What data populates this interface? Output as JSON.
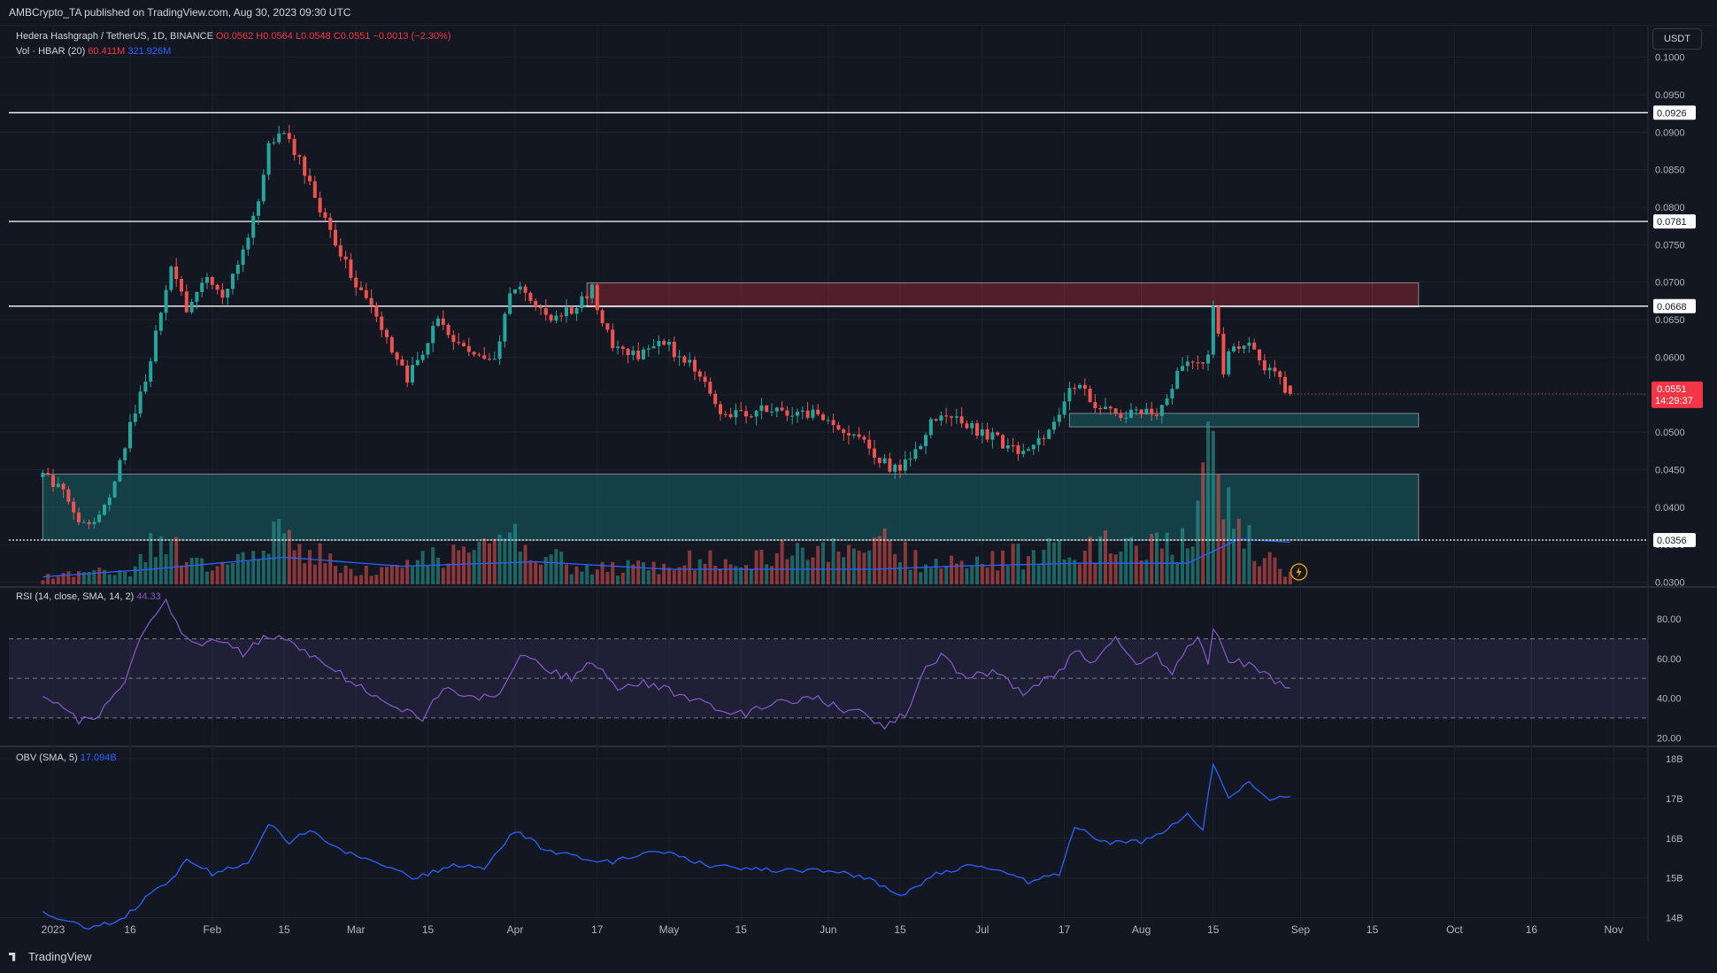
{
  "header": {
    "published": "AMBCrypto_TA published on TradingView.com, Aug 30, 2023 09:30 UTC"
  },
  "legend": {
    "symbol": "Hedera Hashgraph / TetherUS, 1D, BINANCE",
    "o": "O0.0562",
    "h": "H0.0564",
    "l": "L0.0548",
    "c": "C0.0551",
    "chg": "−0.0013 (−2.30%)",
    "vol_label": "Vol · HBAR (20)",
    "vol_val": "60.411M",
    "vol_sma": "321.926M",
    "rsi_label": "RSI (14, close, SMA, 14, 2)",
    "rsi_val": "44.33",
    "obv_label": "OBV (SMA, 5)",
    "obv_val": "17.094B"
  },
  "currency_button": "USDT",
  "price_badge": {
    "price": "0.0551",
    "countdown": "14:29:37"
  },
  "footer": {
    "brand": "TradingView"
  },
  "colors": {
    "up": "#26a69a",
    "down": "#ef5350",
    "bg": "#131722",
    "grid": "#1e222d",
    "volume_sma": "#2962ff",
    "rsi": "#7e57c2",
    "obv": "#2962ff",
    "supply_zone": "#f23645",
    "demand_zone": "#1b8a8a"
  },
  "chart_data": [
    {
      "type": "candlestick",
      "title": "Hedera Hashgraph / TetherUS, 1D, BINANCE",
      "x_ticks": [
        "2023",
        "16",
        "Feb",
        "15",
        "Mar",
        "15",
        "Apr",
        "17",
        "May",
        "15",
        "Jun",
        "15",
        "Jul",
        "17",
        "Aug",
        "15",
        "Sep",
        "15",
        "Oct",
        "16",
        "Nov"
      ],
      "x_tick_dates": [
        "2023-01-01",
        "2023-01-16",
        "2023-02-01",
        "2023-02-15",
        "2023-03-01",
        "2023-03-15",
        "2023-04-01",
        "2023-04-17",
        "2023-05-01",
        "2023-05-15",
        "2023-06-01",
        "2023-06-15",
        "2023-07-01",
        "2023-07-17",
        "2023-08-01",
        "2023-08-15",
        "2023-09-01",
        "2023-09-15",
        "2023-10-01",
        "2023-10-16",
        "2023-11-01"
      ],
      "y_ticks": [
        "0.1000",
        "0.0950",
        "0.0900",
        "0.0850",
        "0.0800",
        "0.0750",
        "0.0700",
        "0.0650",
        "0.0600",
        "0.0550",
        "0.0500",
        "0.0450",
        "0.0400",
        "0.0350",
        "0.0300"
      ],
      "ylim": [
        0.0297,
        0.1035
      ],
      "horizontal_levels": [
        {
          "value": 0.0926,
          "label": "0.0926"
        },
        {
          "value": 0.0781,
          "label": "0.0781"
        },
        {
          "value": 0.0668,
          "label": "0.0668"
        },
        {
          "value": 0.0356,
          "label": "0.0356",
          "dotted": true
        }
      ],
      "zones": [
        {
          "kind": "supply",
          "from": "2023-04-15",
          "to": "2023-09-24",
          "low": 0.0667,
          "high": 0.0699
        },
        {
          "kind": "demand",
          "from": "2023-07-18",
          "to": "2023-09-24",
          "low": 0.0507,
          "high": 0.0525
        },
        {
          "kind": "demand",
          "from": "2022-12-30",
          "to": "2023-09-24",
          "low": 0.0356,
          "high": 0.0444
        }
      ],
      "price_anchors": [
        [
          "2022-12-30",
          0.044
        ],
        [
          "2023-01-03",
          0.042
        ],
        [
          "2023-01-06",
          0.0372
        ],
        [
          "2023-01-10",
          0.0388
        ],
        [
          "2023-01-13",
          0.0435
        ],
        [
          "2023-01-17",
          0.053
        ],
        [
          "2023-01-20",
          0.059
        ],
        [
          "2023-01-22",
          0.0665
        ],
        [
          "2023-01-24",
          0.072
        ],
        [
          "2023-01-27",
          0.0665
        ],
        [
          "2023-01-31",
          0.071
        ],
        [
          "2023-02-03",
          0.068
        ],
        [
          "2023-02-06",
          0.073
        ],
        [
          "2023-02-10",
          0.08
        ],
        [
          "2023-02-12",
          0.088
        ],
        [
          "2023-02-15",
          0.0905
        ],
        [
          "2023-02-18",
          0.086
        ],
        [
          "2023-02-22",
          0.08
        ],
        [
          "2023-02-26",
          0.074
        ],
        [
          "2023-03-01",
          0.07
        ],
        [
          "2023-03-04",
          0.067
        ],
        [
          "2023-03-08",
          0.061
        ],
        [
          "2023-03-11",
          0.057
        ],
        [
          "2023-03-14",
          0.061
        ],
        [
          "2023-03-17",
          0.065
        ],
        [
          "2023-03-20",
          0.062
        ],
        [
          "2023-03-24",
          0.06
        ],
        [
          "2023-03-28",
          0.059
        ],
        [
          "2023-03-31",
          0.069
        ],
        [
          "2023-04-02",
          0.07
        ],
        [
          "2023-04-05",
          0.066
        ],
        [
          "2023-04-09",
          0.0655
        ],
        [
          "2023-04-13",
          0.0665
        ],
        [
          "2023-04-16",
          0.069
        ],
        [
          "2023-04-18",
          0.065
        ],
        [
          "2023-04-20",
          0.061
        ],
        [
          "2023-04-25",
          0.0605
        ],
        [
          "2023-04-29",
          0.0625
        ],
        [
          "2023-05-03",
          0.06
        ],
        [
          "2023-05-07",
          0.058
        ],
        [
          "2023-05-11",
          0.053
        ],
        [
          "2023-05-15",
          0.0525
        ],
        [
          "2023-05-20",
          0.053
        ],
        [
          "2023-05-25",
          0.0525
        ],
        [
          "2023-05-30",
          0.0525
        ],
        [
          "2023-06-03",
          0.0505
        ],
        [
          "2023-06-07",
          0.049
        ],
        [
          "2023-06-10",
          0.047
        ],
        [
          "2023-06-14",
          0.045
        ],
        [
          "2023-06-18",
          0.047
        ],
        [
          "2023-06-21",
          0.051
        ],
        [
          "2023-06-24",
          0.0525
        ],
        [
          "2023-06-28",
          0.051
        ],
        [
          "2023-07-02",
          0.0495
        ],
        [
          "2023-07-07",
          0.048
        ],
        [
          "2023-07-10",
          0.047
        ],
        [
          "2023-07-13",
          0.0495
        ],
        [
          "2023-07-16",
          0.053
        ],
        [
          "2023-07-19",
          0.0565
        ],
        [
          "2023-07-23",
          0.0535
        ],
        [
          "2023-07-27",
          0.0525
        ],
        [
          "2023-08-01",
          0.0525
        ],
        [
          "2023-08-05",
          0.053
        ],
        [
          "2023-08-08",
          0.058
        ],
        [
          "2023-08-11",
          0.059
        ],
        [
          "2023-08-14",
          0.06
        ],
        [
          "2023-08-15",
          0.067
        ],
        [
          "2023-08-17",
          0.058
        ],
        [
          "2023-08-19",
          0.062
        ],
        [
          "2023-08-22",
          0.0615
        ],
        [
          "2023-08-25",
          0.059
        ],
        [
          "2023-08-28",
          0.057
        ],
        [
          "2023-08-30",
          0.0551
        ]
      ],
      "volume_anchors": [
        [
          "2022-12-30",
          0.05
        ],
        [
          "2023-01-16",
          0.1
        ],
        [
          "2023-01-21",
          0.3
        ],
        [
          "2023-02-01",
          0.12
        ],
        [
          "2023-02-12",
          0.35
        ],
        [
          "2023-02-16",
          0.3
        ],
        [
          "2023-03-01",
          0.1
        ],
        [
          "2023-04-01",
          0.3
        ],
        [
          "2023-04-15",
          0.1
        ],
        [
          "2023-06-14",
          0.3
        ],
        [
          "2023-06-20",
          0.12
        ],
        [
          "2023-07-17",
          0.25
        ],
        [
          "2023-08-10",
          0.3
        ],
        [
          "2023-08-15",
          0.95
        ],
        [
          "2023-08-20",
          0.35
        ],
        [
          "2023-08-30",
          0.08
        ]
      ],
      "volume_sma_anchors": [
        [
          "2022-12-30",
          0.05
        ],
        [
          "2023-01-20",
          0.1
        ],
        [
          "2023-02-15",
          0.18
        ],
        [
          "2023-03-10",
          0.12
        ],
        [
          "2023-04-05",
          0.15
        ],
        [
          "2023-05-01",
          0.1
        ],
        [
          "2023-06-10",
          0.1
        ],
        [
          "2023-06-25",
          0.12
        ],
        [
          "2023-07-20",
          0.14
        ],
        [
          "2023-08-10",
          0.14
        ],
        [
          "2023-08-20",
          0.3
        ],
        [
          "2023-08-30",
          0.28
        ]
      ]
    },
    {
      "type": "line",
      "title": "RSI (14, close, SMA, 14, 2)",
      "y_ticks": [
        "80.00",
        "60.00",
        "40.00",
        "20.00"
      ],
      "ylim": [
        17,
        93
      ],
      "bands": [
        70,
        50,
        30
      ],
      "anchors": [
        [
          "2022-12-30",
          41
        ],
        [
          "2023-01-03",
          36
        ],
        [
          "2023-01-06",
          28
        ],
        [
          "2023-01-10",
          32
        ],
        [
          "2023-01-15",
          48
        ],
        [
          "2023-01-18",
          70
        ],
        [
          "2023-01-20",
          78
        ],
        [
          "2023-01-23",
          88
        ],
        [
          "2023-01-26",
          74
        ],
        [
          "2023-01-30",
          66
        ],
        [
          "2023-02-03",
          70
        ],
        [
          "2023-02-07",
          62
        ],
        [
          "2023-02-12",
          72
        ],
        [
          "2023-02-16",
          68
        ],
        [
          "2023-02-22",
          60
        ],
        [
          "2023-02-28",
          48
        ],
        [
          "2023-03-06",
          40
        ],
        [
          "2023-03-10",
          35
        ],
        [
          "2023-03-14",
          30
        ],
        [
          "2023-03-18",
          45
        ],
        [
          "2023-03-24",
          40
        ],
        [
          "2023-03-29",
          42
        ],
        [
          "2023-04-02",
          62
        ],
        [
          "2023-04-07",
          55
        ],
        [
          "2023-04-12",
          50
        ],
        [
          "2023-04-16",
          58
        ],
        [
          "2023-04-21",
          45
        ],
        [
          "2023-04-26",
          48
        ],
        [
          "2023-05-03",
          42
        ],
        [
          "2023-05-10",
          35
        ],
        [
          "2023-05-16",
          32
        ],
        [
          "2023-05-22",
          38
        ],
        [
          "2023-05-30",
          40
        ],
        [
          "2023-06-04",
          34
        ],
        [
          "2023-06-08",
          32
        ],
        [
          "2023-06-12",
          25
        ],
        [
          "2023-06-16",
          32
        ],
        [
          "2023-06-20",
          55
        ],
        [
          "2023-06-23",
          62
        ],
        [
          "2023-06-28",
          50
        ],
        [
          "2023-07-04",
          54
        ],
        [
          "2023-07-09",
          42
        ],
        [
          "2023-07-13",
          50
        ],
        [
          "2023-07-17",
          55
        ],
        [
          "2023-07-19",
          65
        ],
        [
          "2023-07-23",
          58
        ],
        [
          "2023-07-27",
          70
        ],
        [
          "2023-07-31",
          58
        ],
        [
          "2023-08-04",
          62
        ],
        [
          "2023-08-07",
          52
        ],
        [
          "2023-08-10",
          65
        ],
        [
          "2023-08-12",
          72
        ],
        [
          "2023-08-14",
          58
        ],
        [
          "2023-08-15",
          75
        ],
        [
          "2023-08-18",
          60
        ],
        [
          "2023-08-22",
          57
        ],
        [
          "2023-08-26",
          50
        ],
        [
          "2023-08-30",
          44.33
        ]
      ]
    },
    {
      "type": "line",
      "title": "OBV (SMA, 5)",
      "y_ticks": [
        "18B",
        "17B",
        "16B",
        "15B",
        "14B"
      ],
      "ylim": [
        13.7,
        18.2
      ],
      "anchors": [
        [
          "2022-12-30",
          14.15
        ],
        [
          "2023-01-07",
          13.75
        ],
        [
          "2023-01-14",
          13.9
        ],
        [
          "2023-01-20",
          14.6
        ],
        [
          "2023-01-24",
          14.95
        ],
        [
          "2023-01-27",
          15.5
        ],
        [
          "2023-02-01",
          15.1
        ],
        [
          "2023-02-08",
          15.4
        ],
        [
          "2023-02-12",
          16.4
        ],
        [
          "2023-02-16",
          15.9
        ],
        [
          "2023-02-20",
          16.2
        ],
        [
          "2023-02-26",
          15.7
        ],
        [
          "2023-03-05",
          15.4
        ],
        [
          "2023-03-12",
          15.0
        ],
        [
          "2023-03-20",
          15.3
        ],
        [
          "2023-03-26",
          15.25
        ],
        [
          "2023-04-01",
          16.2
        ],
        [
          "2023-04-07",
          15.7
        ],
        [
          "2023-04-14",
          15.5
        ],
        [
          "2023-04-20",
          15.4
        ],
        [
          "2023-04-29",
          15.7
        ],
        [
          "2023-05-09",
          15.3
        ],
        [
          "2023-05-20",
          15.2
        ],
        [
          "2023-05-31",
          15.2
        ],
        [
          "2023-06-09",
          15.0
        ],
        [
          "2023-06-15",
          14.55
        ],
        [
          "2023-06-22",
          15.1
        ],
        [
          "2023-06-28",
          15.3
        ],
        [
          "2023-07-05",
          15.2
        ],
        [
          "2023-07-10",
          14.9
        ],
        [
          "2023-07-16",
          15.1
        ],
        [
          "2023-07-19",
          16.3
        ],
        [
          "2023-07-25",
          15.9
        ],
        [
          "2023-08-01",
          15.9
        ],
        [
          "2023-08-06",
          16.2
        ],
        [
          "2023-08-10",
          16.6
        ],
        [
          "2023-08-13",
          16.2
        ],
        [
          "2023-08-15",
          17.9
        ],
        [
          "2023-08-18",
          17.0
        ],
        [
          "2023-08-22",
          17.4
        ],
        [
          "2023-08-26",
          17.0
        ],
        [
          "2023-08-30",
          17.094
        ]
      ]
    }
  ]
}
